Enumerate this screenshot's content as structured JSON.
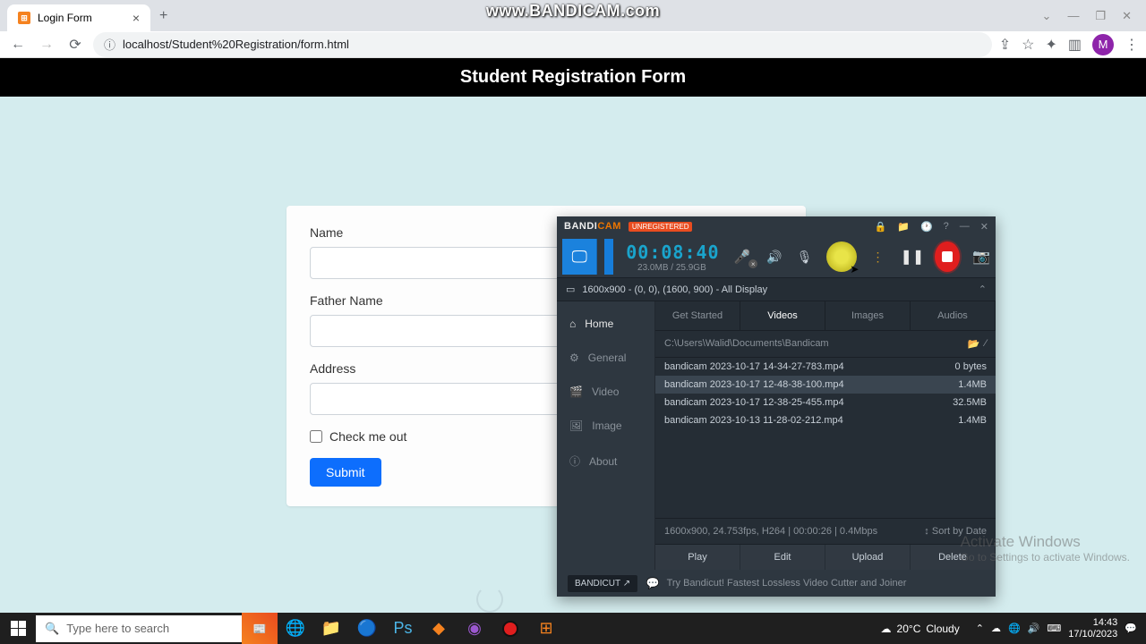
{
  "browser": {
    "tab_title": "Login Form",
    "url": "localhost/Student%20Registration/form.html",
    "profile_initial": "M"
  },
  "watermark": "www.BANDICAM.com",
  "page": {
    "header": "Student Registration Form",
    "form": {
      "name_label": "Name",
      "father_label": "Father Name",
      "address_label": "Address",
      "check_label": "Check me out",
      "submit_label": "Submit"
    }
  },
  "bandicam": {
    "logo_a": "BANDI",
    "logo_b": "CAM",
    "unregistered": "UNREGISTERED",
    "timer": "00:08:40",
    "size_status": "23.0MB / 25.9GB",
    "resolution": "1600x900 - (0, 0), (1600, 900) - All Display",
    "sidebar": {
      "home": "Home",
      "general": "General",
      "video": "Video",
      "image": "Image",
      "about": "About"
    },
    "tabs": {
      "get_started": "Get Started",
      "videos": "Videos",
      "images": "Images",
      "audios": "Audios"
    },
    "path": "C:\\Users\\Walid\\Documents\\Bandicam",
    "files": [
      {
        "name": "bandicam 2023-10-17 14-34-27-783.mp4",
        "size": "0 bytes"
      },
      {
        "name": "bandicam 2023-10-17 12-48-38-100.mp4",
        "size": "1.4MB"
      },
      {
        "name": "bandicam 2023-10-17 12-38-25-455.mp4",
        "size": "32.5MB"
      },
      {
        "name": "bandicam 2023-10-13 11-28-02-212.mp4",
        "size": "1.4MB"
      }
    ],
    "meta": "1600x900, 24.753fps, H264 | 00:00:26 | 0.4Mbps",
    "sort": "Sort by Date",
    "actions": {
      "play": "Play",
      "edit": "Edit",
      "upload": "Upload",
      "delete": "Delete"
    },
    "bandicut": "BANDICUT ↗",
    "footer": "Try Bandicut! Fastest Lossless Video Cutter and Joiner"
  },
  "activate": {
    "title": "Activate Windows",
    "sub": "Go to Settings to activate Windows."
  },
  "taskbar": {
    "search_placeholder": "Type here to search",
    "weather_temp": "20°C",
    "weather_cond": "Cloudy",
    "time": "14:43",
    "date": "17/10/2023"
  }
}
